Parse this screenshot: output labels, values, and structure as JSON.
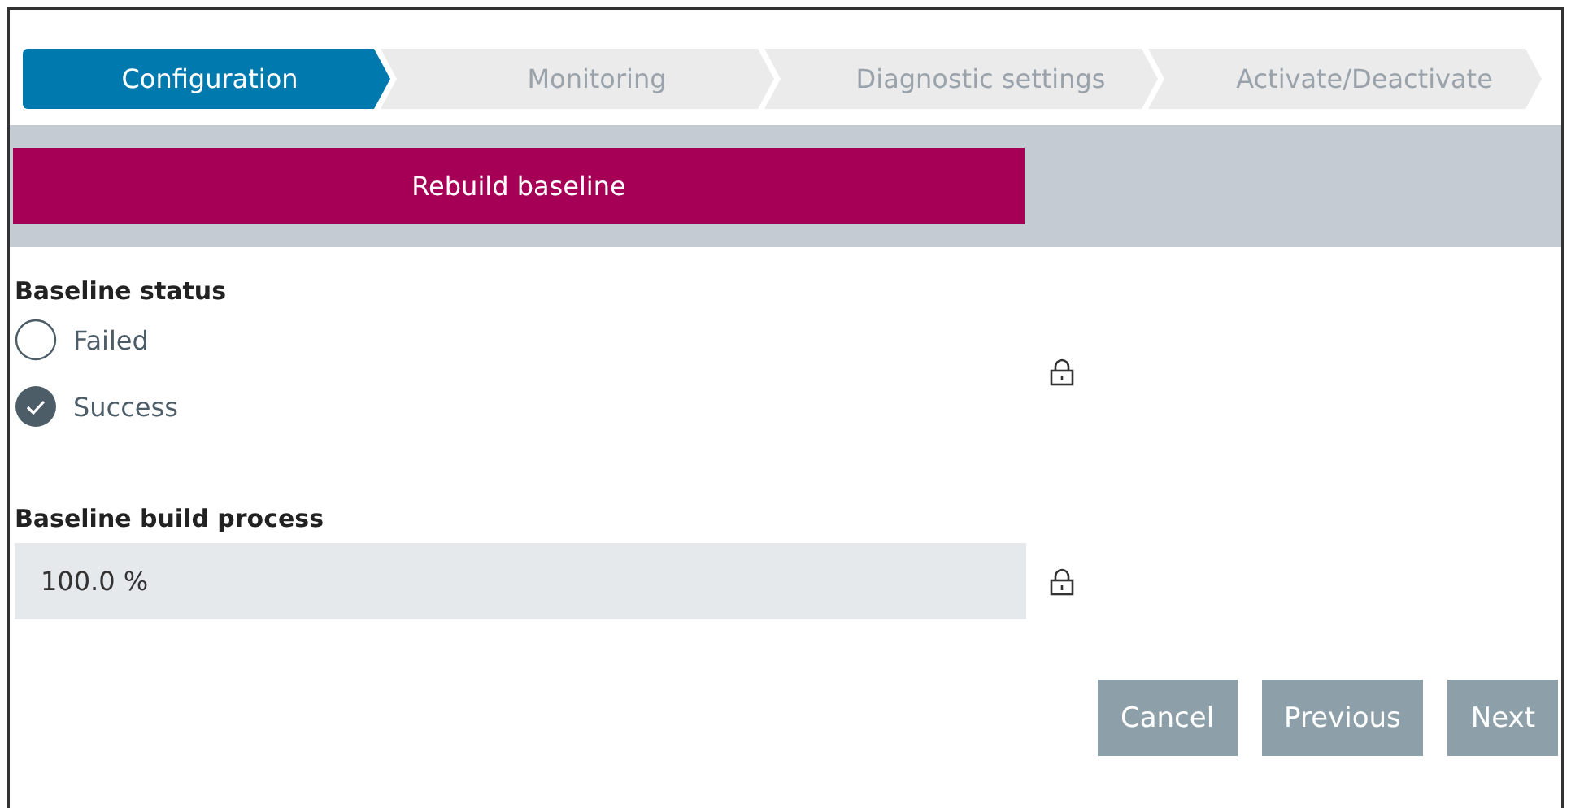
{
  "steps": [
    {
      "label": "Configuration",
      "selected": true
    },
    {
      "label": "Monitoring",
      "selected": false
    },
    {
      "label": "Diagnostic settings",
      "selected": false
    },
    {
      "label": "Activate/Deactivate",
      "selected": false
    }
  ],
  "action_button": "Rebuild baseline",
  "baseline_status": {
    "label": "Baseline status",
    "locked": true,
    "options": [
      {
        "label": "Failed",
        "selected": false
      },
      {
        "label": "Success",
        "selected": true
      }
    ]
  },
  "build_process": {
    "label": "Baseline build process",
    "value": "100.0 %",
    "locked": true
  },
  "buttons": [
    "Cancel",
    "Previous",
    "Next"
  ]
}
